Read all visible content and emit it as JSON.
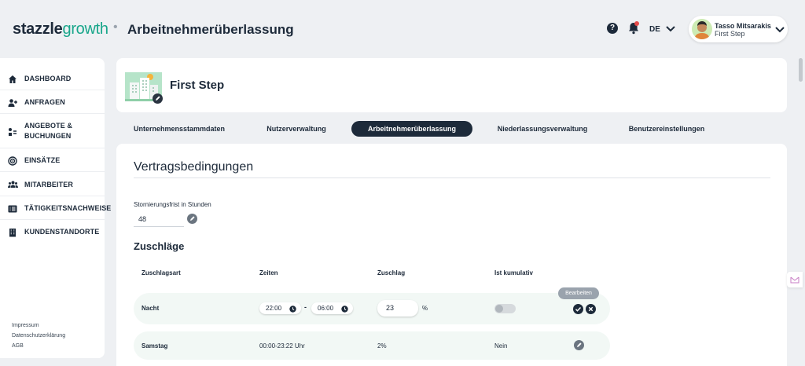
{
  "header": {
    "logo_bold": "stazzle",
    "logo_light": "growth",
    "separator": "•",
    "title": "Arbeitnehmerüberlassung",
    "help_symbol": "?",
    "language": "DE",
    "user_name": "Tasso Mitsarakis",
    "user_company": "First Step"
  },
  "sidebar": {
    "items": [
      {
        "label": "DASHBOARD",
        "icon": "home-icon"
      },
      {
        "label": "ANFRAGEN",
        "icon": "add-user-icon"
      },
      {
        "label": "ANGEBOTE &",
        "label2": "BUCHUNGEN",
        "icon": "offers-icon"
      },
      {
        "label": "EINSÄTZE",
        "icon": "target-icon"
      },
      {
        "label": "MITARBEITER",
        "icon": "team-icon"
      },
      {
        "label": "TÄTIGKEITSNACHWEISE",
        "icon": "list-icon"
      },
      {
        "label": "KUNDENSTANDORTE",
        "icon": "building-icon"
      }
    ],
    "footer": [
      "Impressum",
      "Datenschutzerklärung",
      "AGB"
    ]
  },
  "company": {
    "name": "First Step"
  },
  "tabs": [
    {
      "label": "Unternehmensstammdaten",
      "active": false
    },
    {
      "label": "Nutzerverwaltung",
      "active": false
    },
    {
      "label": "Arbeitnehmerüberlassung",
      "active": true
    },
    {
      "label": "Niederlassungsverwaltung",
      "active": false
    },
    {
      "label": "Benutzereinstellungen",
      "active": false
    }
  ],
  "contract": {
    "title": "Vertragsbedingungen",
    "storno_label": "Stornierungsfrist in Stunden",
    "storno_value": "48"
  },
  "surcharges": {
    "title": "Zuschläge",
    "columns": [
      "Zuschlagsart",
      "Zeiten",
      "Zuschlag",
      "Ist kumulativ"
    ],
    "edit_row": {
      "type": "Nacht",
      "time_from": "22:00",
      "time_separator": "-",
      "time_to": "06:00",
      "value": "23",
      "unit": "%",
      "cumulative": false,
      "tooltip": "Bearbeiten"
    },
    "rows": [
      {
        "type": "Samstag",
        "times": "00:00-23:22 Uhr",
        "value": "2%",
        "cumulative": "Nein"
      }
    ]
  },
  "colors": {
    "primary": "#1d2a3a",
    "brand_green": "#18a68a",
    "row_bg": "#f2f8f5",
    "background": "#eef0f3"
  }
}
